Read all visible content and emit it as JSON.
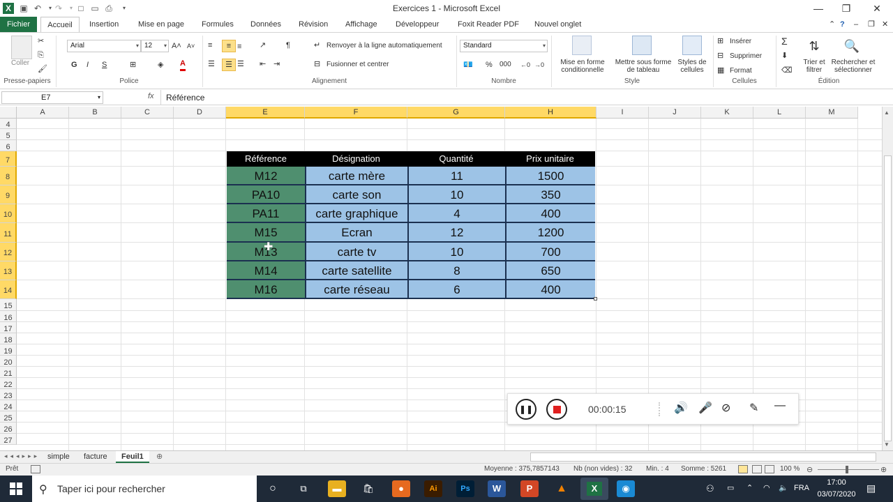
{
  "window": {
    "title": "Exercices 1 - Microsoft Excel"
  },
  "tabs": [
    "Fichier",
    "Accueil",
    "Insertion",
    "Mise en page",
    "Formules",
    "Données",
    "Révision",
    "Affichage",
    "Développeur",
    "Foxit Reader PDF",
    "Nouvel onglet"
  ],
  "ribbon": {
    "clipboard": {
      "paste": "Coller",
      "label": "Presse-papiers"
    },
    "font": {
      "name": "Arial",
      "size": "12",
      "bold": "G",
      "italic": "I",
      "underline": "S",
      "label": "Police"
    },
    "alignment": {
      "wrap": "Renvoyer à la ligne automatiquement",
      "merge": "Fusionner et centrer",
      "label": "Alignement"
    },
    "number": {
      "format": "Standard",
      "percent": "%",
      "thousands": "000",
      "label": "Nombre"
    },
    "style": {
      "cond1": "Mise en forme",
      "cond2": "conditionnelle",
      "table1": "Mettre sous forme",
      "table2": "de tableau",
      "cell1": "Styles de",
      "cell2": "cellules",
      "label": "Style"
    },
    "cells": {
      "insert": "Insérer",
      "delete": "Supprimer",
      "format": "Format",
      "label": "Cellules"
    },
    "editing": {
      "sigma": "Σ",
      "sort1": "Trier et",
      "sort2": "filtrer",
      "find1": "Rechercher et",
      "find2": "sélectionner",
      "label": "Édition"
    }
  },
  "formula_bar": {
    "cell_ref": "E7",
    "fx": "fx",
    "content": "Référence"
  },
  "columns": [
    "A",
    "B",
    "C",
    "D",
    "E",
    "F",
    "G",
    "H",
    "I",
    "J",
    "K",
    "L",
    "M"
  ],
  "rows": [
    "4",
    "5",
    "6",
    "7",
    "8",
    "9",
    "10",
    "11",
    "12",
    "13",
    "14",
    "15",
    "16",
    "17",
    "18",
    "19",
    "20",
    "21",
    "22",
    "23",
    "24",
    "25",
    "26",
    "27"
  ],
  "table": {
    "headers": [
      "Référence",
      "Désignation",
      "Quantité",
      "Prix unitaire"
    ],
    "rows": [
      [
        "M12",
        "carte mère",
        "11",
        "1500"
      ],
      [
        "PA10",
        "carte son",
        "10",
        "350"
      ],
      [
        "PA11",
        "carte graphique",
        "4",
        "400"
      ],
      [
        "M15",
        "Ecran",
        "12",
        "1200"
      ],
      [
        "M13",
        "carte tv",
        "10",
        "700"
      ],
      [
        "M14",
        "carte satellite",
        "8",
        "650"
      ],
      [
        "M16",
        "carte réseau",
        "6",
        "400"
      ]
    ]
  },
  "sheets": [
    "simple",
    "facture",
    "Feuil1"
  ],
  "status": {
    "ready": "Prêt",
    "average": "Moyenne : 375,7857143",
    "count": "Nb (non vides) : 32",
    "min": "Min. : 4",
    "sum": "Somme : 5261",
    "zoom": "100 %"
  },
  "recorder": {
    "time": "00:00:15"
  },
  "taskbar": {
    "search_placeholder": "Taper ici pour rechercher",
    "lang": "FRA",
    "time": "17:00",
    "date": "03/07/2020"
  },
  "colors": {
    "excel_green": "#1f7244",
    "ref_col": "#4f8f6f",
    "data_blue": "#9dc3e6",
    "header_black": "#000000",
    "selected_header": "#ffd966"
  }
}
